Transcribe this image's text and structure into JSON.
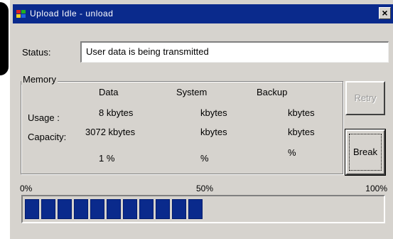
{
  "window": {
    "title": "Upload Idle - unload",
    "icon": "app-icon",
    "close_label": "×"
  },
  "status": {
    "label": "Status:",
    "value": "User data is being transmitted"
  },
  "memory": {
    "group_label": "Memory",
    "columns": [
      "Data",
      "System",
      "Backup"
    ],
    "rows": [
      {
        "label": "Usage :",
        "cells": [
          "8 kbytes",
          "kbytes",
          "kbytes"
        ]
      },
      {
        "label": "Capacity:",
        "cells": [
          "3072 kbytes",
          "kbytes",
          "kbytes"
        ]
      },
      {
        "label": "",
        "cells": [
          "1 %",
          "%",
          "%"
        ]
      }
    ]
  },
  "buttons": {
    "retry": "Retry",
    "break": "Break"
  },
  "progress": {
    "scale_start": "0%",
    "scale_mid": "50%",
    "scale_end": "100%",
    "percent": 50,
    "bar_color": "#0a2a8c"
  }
}
